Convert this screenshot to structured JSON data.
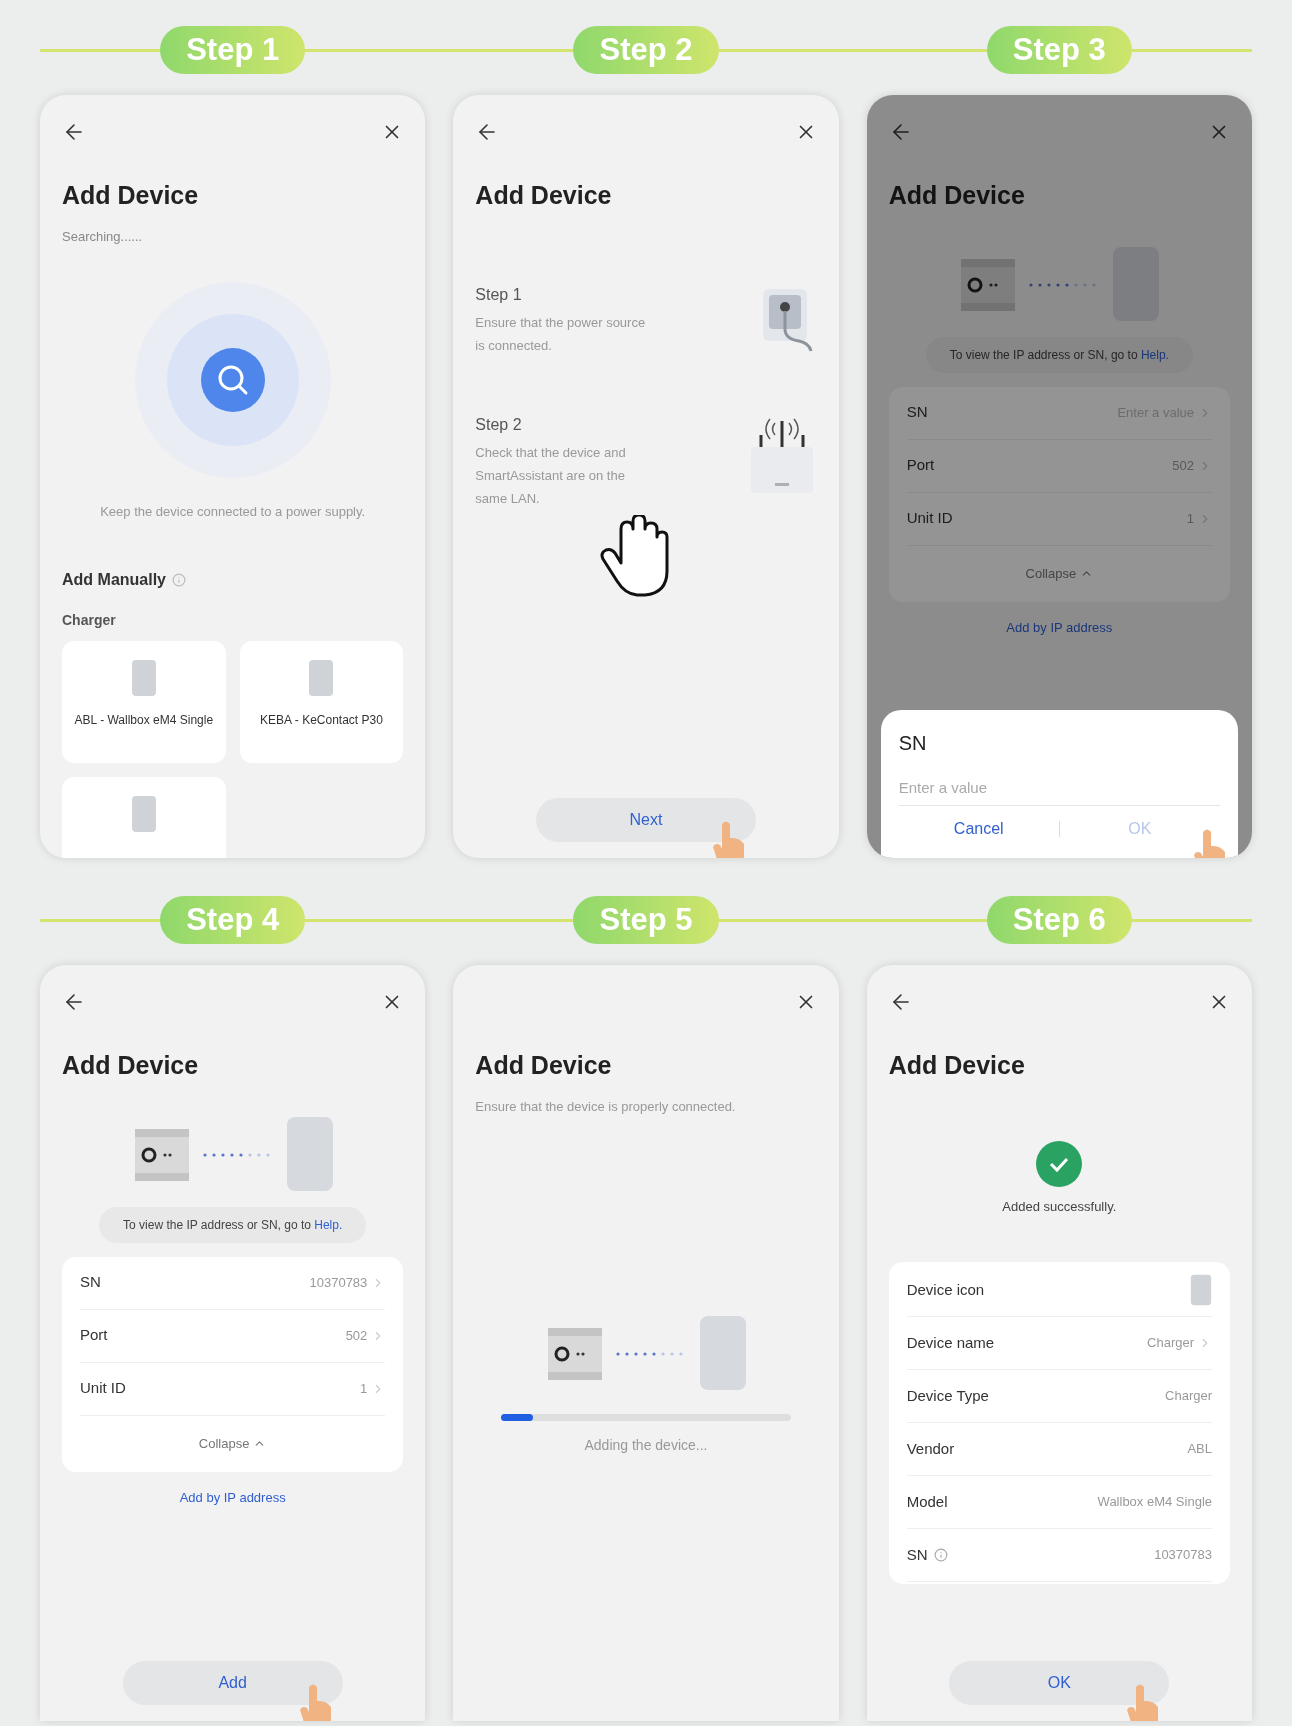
{
  "steps": [
    {
      "label": "Step 1",
      "screen": {
        "kind": "search",
        "back": true,
        "title": "Add Device",
        "subtitle": "Searching......",
        "hint": "Keep the device connected to a power supply.",
        "manual_title": "Add Manually",
        "category": "Charger",
        "devices": [
          {
            "kind": "charger",
            "name": "ABL - Wallbox eM4 Single"
          },
          {
            "kind": "charger",
            "name": "KEBA - KeContact P30"
          },
          {
            "kind": "charger"
          }
        ]
      }
    },
    {
      "label": "Step 2",
      "screen": {
        "kind": "guide",
        "back": true,
        "title": "Add Device",
        "items": [
          {
            "title": "Step 1",
            "text": "Ensure that the power source is connected.",
            "kind": "plug"
          },
          {
            "title": "Step 2",
            "text": "Check that the device and SmartAssistant are on the same LAN.",
            "kind": "router"
          }
        ],
        "cursor": true,
        "button": {
          "label": "Next",
          "pointer": true
        }
      }
    },
    {
      "label": "Step 3",
      "screen": {
        "kind": "form",
        "back": true,
        "dimmed": true,
        "title": "Add Device",
        "help_text": "To view the IP address or SN, go to",
        "help_link": "Help.",
        "fields": [
          {
            "label": "SN",
            "placeholder": "Enter a value",
            "chevron": true
          },
          {
            "label": "Port",
            "value": "502",
            "chevron": true
          },
          {
            "label": "Unit ID",
            "value": "1",
            "chevron": true
          }
        ],
        "collapse": "Collapse",
        "ip_link": "Add by IP address",
        "dialog": {
          "title": "SN",
          "placeholder": "Enter a value",
          "cancel": "Cancel",
          "ok": "OK",
          "ok_disabled": true,
          "pointer": true
        }
      }
    },
    {
      "label": "Step 4",
      "screen": {
        "kind": "form",
        "back": true,
        "dimmed": false,
        "title": "Add Device",
        "help_text": "To view the IP address or SN, go to",
        "help_link": "Help.",
        "fields": [
          {
            "label": "SN",
            "value": "10370783",
            "chevron": true
          },
          {
            "label": "Port",
            "value": "502",
            "chevron": true
          },
          {
            "label": "Unit ID",
            "value": "1",
            "chevron": true
          }
        ],
        "collapse": "Collapse",
        "ip_link": "Add by IP address",
        "button": {
          "label": "Add",
          "pointer": true
        }
      }
    },
    {
      "label": "Step 5",
      "screen": {
        "kind": "progress",
        "back": false,
        "title": "Add Device",
        "subtitle": "Ensure that the device is properly connected.",
        "level": 0.11,
        "status": "Adding the device..."
      }
    },
    {
      "label": "Step 6",
      "screen": {
        "kind": "result",
        "back": true,
        "title": "Add Device",
        "status": "Added successfully.",
        "fields": [
          {
            "kind": "icon",
            "label": "Device icon",
            "chevron": false
          },
          {
            "kind": "text",
            "label": "Device name",
            "value": "Charger",
            "chevron": true
          },
          {
            "kind": "text",
            "label": "Device Type",
            "value": "Charger",
            "chevron": false
          },
          {
            "kind": "text",
            "label": "Vendor",
            "value": "ABL",
            "chevron": false
          },
          {
            "kind": "text",
            "label": "Model",
            "value": "Wallbox eM4 Single",
            "chevron": false
          },
          {
            "kind": "text",
            "label": "SN",
            "value": "10370783",
            "info": true,
            "chevron": false
          }
        ],
        "button": {
          "label": "OK",
          "pointer": true
        }
      }
    }
  ]
}
